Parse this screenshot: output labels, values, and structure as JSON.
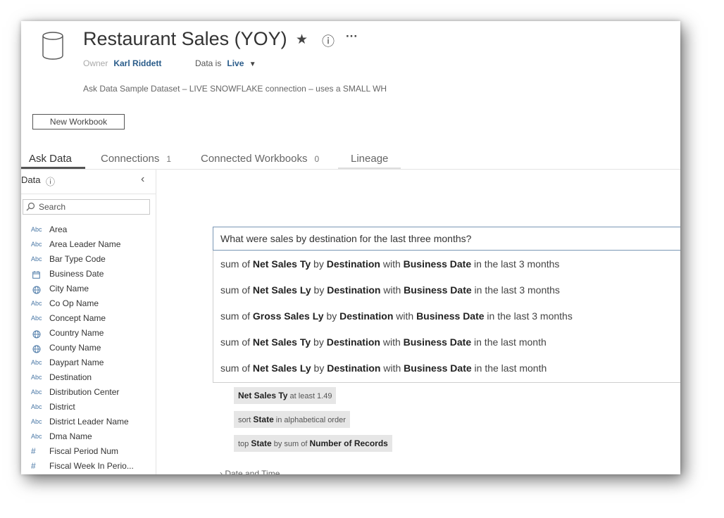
{
  "header": {
    "title": "Restaurant Sales (YOY)",
    "owner_label": "Owner",
    "owner_name": "Karl Riddett",
    "data_is_label": "Data is",
    "data_mode": "Live",
    "description": "Ask Data Sample Dataset – LIVE SNOWFLAKE connection – uses a SMALL WH",
    "star_icon": "★",
    "info_icon": "ⓘ",
    "more_icon": "···",
    "dropdown_icon": "▼"
  },
  "new_workbook_label": "New Workbook",
  "tabs": [
    {
      "label": "Ask Data",
      "count": ""
    },
    {
      "label": "Connections",
      "count": "1"
    },
    {
      "label": "Connected Workbooks",
      "count": "0"
    },
    {
      "label": "Lineage",
      "count": ""
    }
  ],
  "sidebar": {
    "title": "Data",
    "info_icon": "ⓘ",
    "collapse_icon": "‹",
    "search_placeholder": "Search",
    "fields": [
      {
        "type": "Abc",
        "name": "Area"
      },
      {
        "type": "Abc",
        "name": "Area Leader Name"
      },
      {
        "type": "Abc",
        "name": "Bar Type Code"
      },
      {
        "type": "calendar",
        "name": "Business Date"
      },
      {
        "type": "globe",
        "name": "City Name"
      },
      {
        "type": "Abc",
        "name": "Co Op Name"
      },
      {
        "type": "Abc",
        "name": "Concept Name"
      },
      {
        "type": "globe",
        "name": "Country Name"
      },
      {
        "type": "globe",
        "name": "County Name"
      },
      {
        "type": "Abc",
        "name": "Daypart Name"
      },
      {
        "type": "Abc",
        "name": "Destination"
      },
      {
        "type": "Abc",
        "name": "Distribution Center"
      },
      {
        "type": "Abc",
        "name": "District"
      },
      {
        "type": "Abc",
        "name": "District Leader Name"
      },
      {
        "type": "Abc",
        "name": "Dma Name"
      },
      {
        "type": "#",
        "name": "Fiscal Period Num"
      },
      {
        "type": "#",
        "name": "Fiscal Week In Perio..."
      }
    ]
  },
  "ask": {
    "query": "What were sales by destination for the last three months?",
    "suggestions": [
      [
        {
          "t": "sum of ",
          "b": false
        },
        {
          "t": "Net Sales Ty",
          "b": true
        },
        {
          "t": " by ",
          "b": false
        },
        {
          "t": "Destination",
          "b": true
        },
        {
          "t": " with ",
          "b": false
        },
        {
          "t": "Business Date",
          "b": true
        },
        {
          "t": " in the last 3 months",
          "b": false
        }
      ],
      [
        {
          "t": "sum of ",
          "b": false
        },
        {
          "t": "Net Sales Ly",
          "b": true
        },
        {
          "t": " by ",
          "b": false
        },
        {
          "t": "Destination",
          "b": true
        },
        {
          "t": " with ",
          "b": false
        },
        {
          "t": "Business Date",
          "b": true
        },
        {
          "t": " in the last 3 months",
          "b": false
        }
      ],
      [
        {
          "t": "sum of ",
          "b": false
        },
        {
          "t": "Gross Sales Ly",
          "b": true
        },
        {
          "t": " by ",
          "b": false
        },
        {
          "t": "Destination",
          "b": true
        },
        {
          "t": " with ",
          "b": false
        },
        {
          "t": "Business Date",
          "b": true
        },
        {
          "t": " in the last 3 months",
          "b": false
        }
      ],
      [
        {
          "t": "sum of ",
          "b": false
        },
        {
          "t": "Net Sales Ty",
          "b": true
        },
        {
          "t": " by ",
          "b": false
        },
        {
          "t": "Destination",
          "b": true
        },
        {
          "t": " with ",
          "b": false
        },
        {
          "t": "Business Date",
          "b": true
        },
        {
          "t": " in the last month",
          "b": false
        }
      ],
      [
        {
          "t": "sum of ",
          "b": false
        },
        {
          "t": "Net Sales Ly",
          "b": true
        },
        {
          "t": " by ",
          "b": false
        },
        {
          "t": "Destination",
          "b": true
        },
        {
          "t": " with ",
          "b": false
        },
        {
          "t": "Business Date",
          "b": true
        },
        {
          "t": " in the last month",
          "b": false
        }
      ]
    ],
    "recommendations": [
      [
        {
          "t": "Net Sales Ty",
          "b": true
        },
        {
          "t": " at least 1.49",
          "b": false
        }
      ],
      [
        {
          "t": "sort ",
          "b": false
        },
        {
          "t": "State",
          "b": true
        },
        {
          "t": " in alphabetical order",
          "b": false
        }
      ],
      [
        {
          "t": "top ",
          "b": false
        },
        {
          "t": "State",
          "b": true
        },
        {
          "t": " by sum of ",
          "b": false
        },
        {
          "t": "Number of Records",
          "b": true
        }
      ]
    ],
    "section_label": "›    Date and Time"
  }
}
